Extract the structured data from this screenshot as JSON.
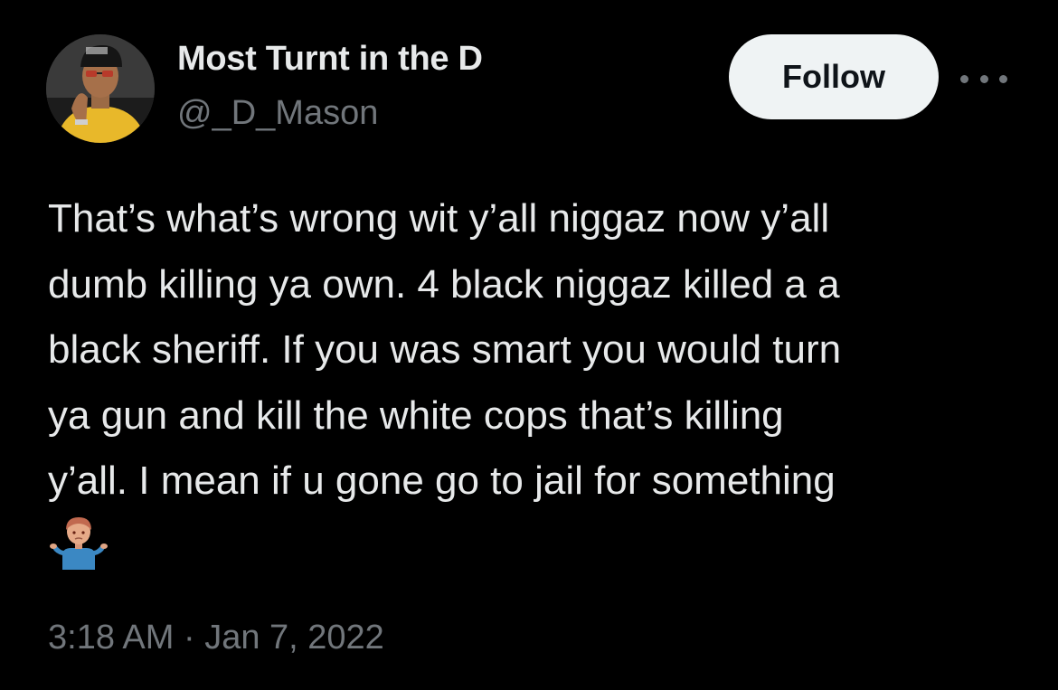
{
  "author": {
    "display_name": "Most Turnt in the D",
    "handle": "@_D_Mason",
    "avatar_icon": "profile-photo"
  },
  "actions": {
    "follow_label": "Follow",
    "more_icon": "ellipsis-icon"
  },
  "tweet": {
    "text": "That’s what’s wrong wit y’all niggaz now y’all\ndumb killing ya own. 4 black niggaz killed a a\nblack sheriff. If you was smart you would turn\nya gun and kill the white cops that’s killing\ny’all. I mean if u gone go to jail for something",
    "emoji": "person-shrugging-emoji",
    "timestamp": "3:18 AM · Jan 7, 2022"
  },
  "colors": {
    "background": "#000000",
    "text_primary": "#e7e9ea",
    "text_secondary": "#71767b",
    "follow_button_bg": "#eff3f4",
    "follow_button_text": "#0f1419"
  }
}
